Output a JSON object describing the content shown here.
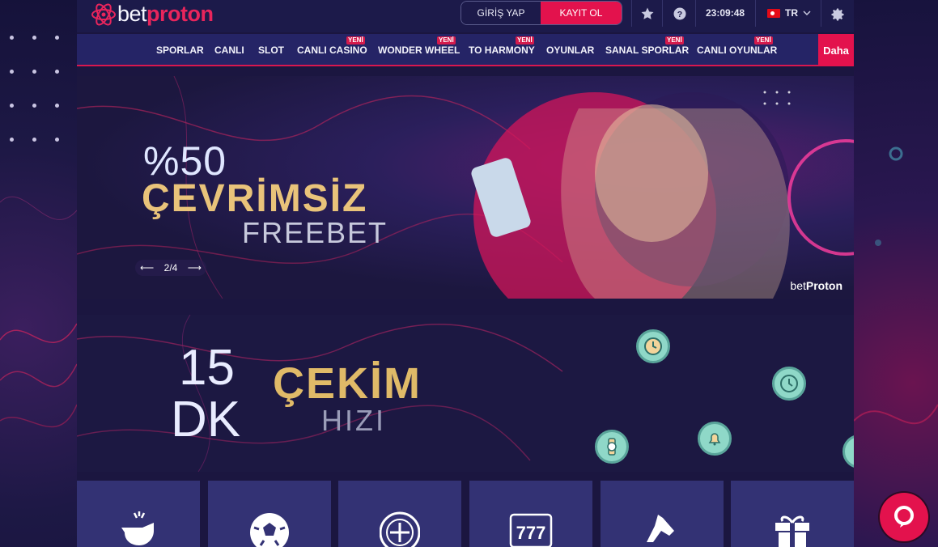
{
  "brand": {
    "part1": "bet",
    "part2": "proton"
  },
  "auth": {
    "login_label": "GİRİŞ YAP",
    "register_label": "KAYIT OL"
  },
  "topbar": {
    "clock": "23:09:48",
    "language": "TR",
    "icons": [
      "star-icon",
      "help-icon",
      "settings-icon"
    ]
  },
  "nav": {
    "items": [
      {
        "label": "SPORLAR",
        "badge": ""
      },
      {
        "label": "CANLI",
        "badge": ""
      },
      {
        "label": "SLOT",
        "badge": ""
      },
      {
        "label": "CANLI CASINO",
        "badge": "YENİ"
      },
      {
        "label": "WONDER WHEEL",
        "badge": "YENİ"
      },
      {
        "label": "TO HARMONY",
        "badge": "YENİ"
      },
      {
        "label": "OYUNLAR",
        "badge": ""
      },
      {
        "label": "SANAL SPORLAR",
        "badge": "YENİ"
      },
      {
        "label": "CANLI OYUNLAR",
        "badge": "YENİ"
      }
    ],
    "more_label": "Daha"
  },
  "banner1": {
    "percent": "%50",
    "headline": "ÇEVRİMSİZ",
    "sub": "FREEBET",
    "slide": "2/4",
    "brand_light": "bet",
    "brand_bold": "Proton"
  },
  "banner2": {
    "number": "15",
    "unit": "DK",
    "headline": "ÇEKİM",
    "sub": "HIZI"
  },
  "tiles": [
    "whistle-icon",
    "soccer-ball-icon",
    "roulette-icon",
    "slot-777-icon",
    "horse-icon",
    "gift-icon"
  ],
  "colors": {
    "accent": "#e3124d",
    "nav_bg": "#252466",
    "tile_bg": "#333274",
    "gold": "#e0ba68"
  }
}
